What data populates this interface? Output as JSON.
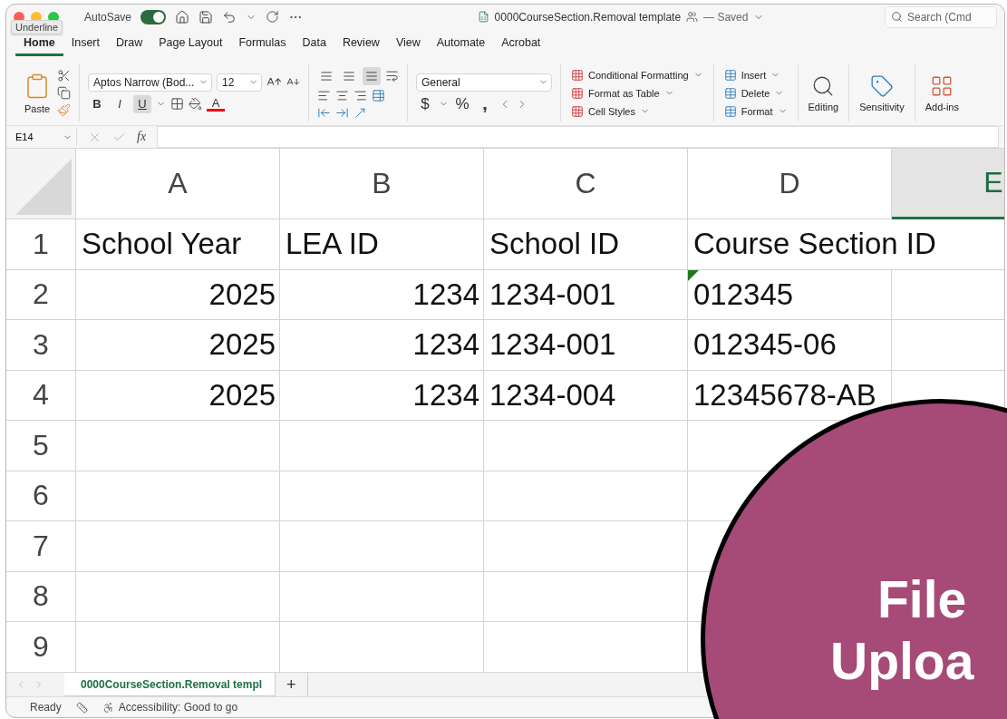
{
  "window": {
    "title": "0000CourseSection.Removal template",
    "save_status": "— Saved",
    "autosave": {
      "label": "AutoSave",
      "on": true
    }
  },
  "search": {
    "placeholder": "Search (Cmd"
  },
  "tooltip": "Underline",
  "tabs": [
    {
      "label": "Home",
      "selected": true
    },
    {
      "label": "Insert",
      "selected": false
    },
    {
      "label": "Draw",
      "selected": false
    },
    {
      "label": "Page Layout",
      "selected": false
    },
    {
      "label": "Formulas",
      "selected": false
    },
    {
      "label": "Data",
      "selected": false
    },
    {
      "label": "Review",
      "selected": false
    },
    {
      "label": "View",
      "selected": false
    },
    {
      "label": "Automate",
      "selected": false
    },
    {
      "label": "Acrobat",
      "selected": false
    }
  ],
  "ribbon": {
    "paste_label": "Paste",
    "font_name": "Aptos Narrow (Bod...",
    "font_size": "12",
    "font_styles": [
      {
        "label": "B",
        "kind": "bold",
        "selected": false
      },
      {
        "label": "I",
        "kind": "italic",
        "selected": false
      },
      {
        "label": "U",
        "kind": "underline",
        "selected": true
      }
    ],
    "font_color_label": "A",
    "vertical_align": [
      {
        "selected": false
      },
      {
        "selected": false
      },
      {
        "selected": true
      }
    ],
    "number_format": "General",
    "currency": "$",
    "percent": "%",
    "comma": ",",
    "styles": [
      "Conditional Formatting",
      "Format as Table",
      "Cell Styles"
    ],
    "cells": [
      "Insert",
      "Delete",
      "Format"
    ],
    "editing": "Editing",
    "sensitivity": "Sensitivity",
    "addins": "Add-ins"
  },
  "formula_bar": {
    "name_box": "E14",
    "fx": "fx"
  },
  "sheet": {
    "columns": [
      {
        "label": "A",
        "selected": false
      },
      {
        "label": "B",
        "selected": false
      },
      {
        "label": "C",
        "selected": false
      },
      {
        "label": "D",
        "selected": false
      },
      {
        "label": "E",
        "selected": true
      }
    ],
    "rows": [
      {
        "number": "1",
        "cells": [
          {
            "text": "School Year",
            "kind": "text",
            "flag": false
          },
          {
            "text": "LEA ID",
            "kind": "text",
            "flag": false
          },
          {
            "text": "School ID",
            "kind": "text",
            "flag": false
          },
          {
            "text": "Course Section ID",
            "kind": "text",
            "flag": false
          }
        ]
      },
      {
        "number": "2",
        "cells": [
          {
            "text": "2025",
            "kind": "number",
            "flag": false
          },
          {
            "text": "1234",
            "kind": "number",
            "flag": false
          },
          {
            "text": "1234-001",
            "kind": "text",
            "flag": false
          },
          {
            "text": "012345",
            "kind": "text",
            "flag": true
          }
        ]
      },
      {
        "number": "3",
        "cells": [
          {
            "text": "2025",
            "kind": "number",
            "flag": false
          },
          {
            "text": "1234",
            "kind": "number",
            "flag": false
          },
          {
            "text": "1234-001",
            "kind": "text",
            "flag": false
          },
          {
            "text": "012345-06",
            "kind": "text",
            "flag": false
          }
        ]
      },
      {
        "number": "4",
        "cells": [
          {
            "text": "2025",
            "kind": "number",
            "flag": false
          },
          {
            "text": "1234",
            "kind": "number",
            "flag": false
          },
          {
            "text": "1234-004",
            "kind": "text",
            "flag": false
          },
          {
            "text": "12345678-AB",
            "kind": "text",
            "flag": false
          }
        ]
      },
      {
        "number": "5"
      },
      {
        "number": "6"
      },
      {
        "number": "7"
      },
      {
        "number": "8"
      },
      {
        "number": "9"
      }
    ]
  },
  "sheet_tabs": [
    {
      "label": "0000CourseSection.Removal templ",
      "selected": true
    }
  ],
  "add_sheet": "+",
  "status_bar": {
    "ready": "Ready",
    "accessibility": "Accessibility: Good to go"
  },
  "overlay": {
    "lines": [
      "File",
      "Uploa"
    ]
  }
}
